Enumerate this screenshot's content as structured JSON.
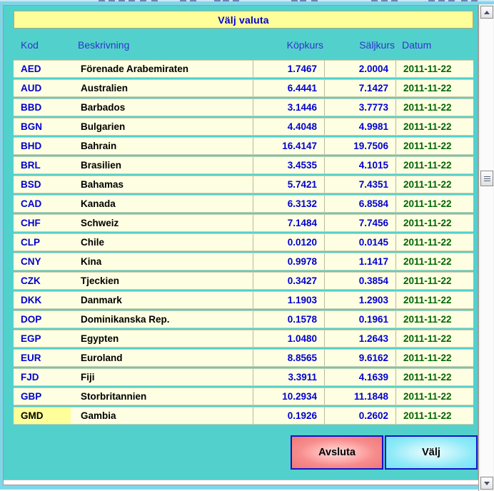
{
  "window": {
    "title": "Välj valuta"
  },
  "table": {
    "columns": [
      {
        "key": "kod",
        "label": "Kod"
      },
      {
        "key": "besk",
        "label": "Beskrivning"
      },
      {
        "key": "kop",
        "label": "Köpkurs"
      },
      {
        "key": "salj",
        "label": "Säljkurs"
      },
      {
        "key": "datum",
        "label": "Datum"
      }
    ],
    "rows": [
      {
        "kod": "AED",
        "besk": "Förenade Arabemiraten",
        "kop": "1.7467",
        "salj": "2.0004",
        "datum": "2011-11-22",
        "selected": false
      },
      {
        "kod": "AUD",
        "besk": "Australien",
        "kop": "6.4441",
        "salj": "7.1427",
        "datum": "2011-11-22",
        "selected": false
      },
      {
        "kod": "BBD",
        "besk": "Barbados",
        "kop": "3.1446",
        "salj": "3.7773",
        "datum": "2011-11-22",
        "selected": false
      },
      {
        "kod": "BGN",
        "besk": "Bulgarien",
        "kop": "4.4048",
        "salj": "4.9981",
        "datum": "2011-11-22",
        "selected": false
      },
      {
        "kod": "BHD",
        "besk": "Bahrain",
        "kop": "16.4147",
        "salj": "19.7506",
        "datum": "2011-11-22",
        "selected": false
      },
      {
        "kod": "BRL",
        "besk": "Brasilien",
        "kop": "3.4535",
        "salj": "4.1015",
        "datum": "2011-11-22",
        "selected": false
      },
      {
        "kod": "BSD",
        "besk": "Bahamas",
        "kop": "5.7421",
        "salj": "7.4351",
        "datum": "2011-11-22",
        "selected": false
      },
      {
        "kod": "CAD",
        "besk": "Kanada",
        "kop": "6.3132",
        "salj": "6.8584",
        "datum": "2011-11-22",
        "selected": false
      },
      {
        "kod": "CHF",
        "besk": "Schweiz",
        "kop": "7.1484",
        "salj": "7.7456",
        "datum": "2011-11-22",
        "selected": false
      },
      {
        "kod": "CLP",
        "besk": "Chile",
        "kop": "0.0120",
        "salj": "0.0145",
        "datum": "2011-11-22",
        "selected": false
      },
      {
        "kod": "CNY",
        "besk": "Kina",
        "kop": "0.9978",
        "salj": "1.1417",
        "datum": "2011-11-22",
        "selected": false
      },
      {
        "kod": "CZK",
        "besk": "Tjeckien",
        "kop": "0.3427",
        "salj": "0.3854",
        "datum": "2011-11-22",
        "selected": false
      },
      {
        "kod": "DKK",
        "besk": "Danmark",
        "kop": "1.1903",
        "salj": "1.2903",
        "datum": "2011-11-22",
        "selected": false
      },
      {
        "kod": "DOP",
        "besk": "Dominikanska Rep.",
        "kop": "0.1578",
        "salj": "0.1961",
        "datum": "2011-11-22",
        "selected": false
      },
      {
        "kod": "EGP",
        "besk": "Egypten",
        "kop": "1.0480",
        "salj": "1.2643",
        "datum": "2011-11-22",
        "selected": false
      },
      {
        "kod": "EUR",
        "besk": "Euroland",
        "kop": "8.8565",
        "salj": "9.6162",
        "datum": "2011-11-22",
        "selected": false
      },
      {
        "kod": "FJD",
        "besk": "Fiji",
        "kop": "3.3911",
        "salj": "4.1639",
        "datum": "2011-11-22",
        "selected": false
      },
      {
        "kod": "GBP",
        "besk": "Storbritannien",
        "kop": "10.2934",
        "salj": "11.1848",
        "datum": "2011-11-22",
        "selected": false
      },
      {
        "kod": "GMD",
        "besk": "Gambia",
        "kop": "0.1926",
        "salj": "0.2602",
        "datum": "2011-11-22",
        "selected": true
      }
    ]
  },
  "buttons": {
    "cancel": "Avsluta",
    "select": "Välj"
  },
  "scrollbar": {
    "up_icon": "chevron-up-icon",
    "down_icon": "chevron-down-icon",
    "thumb_icon": "scrollbar-thumb-grip"
  },
  "colors": {
    "panel_teal": "#52d1cc",
    "frame_teal": "#7fd6e8",
    "titlebar_yellow": "#ffff99",
    "row_cream": "#fefee2",
    "code_blue": "#0000d0",
    "header_blue": "#3333cc",
    "date_green": "#006600",
    "button_border_blue": "#1414c8",
    "button_cancel_red": "#ef7878",
    "button_select_cyan": "#74e4f7",
    "selected_cell_yellow": "#ffff99"
  }
}
